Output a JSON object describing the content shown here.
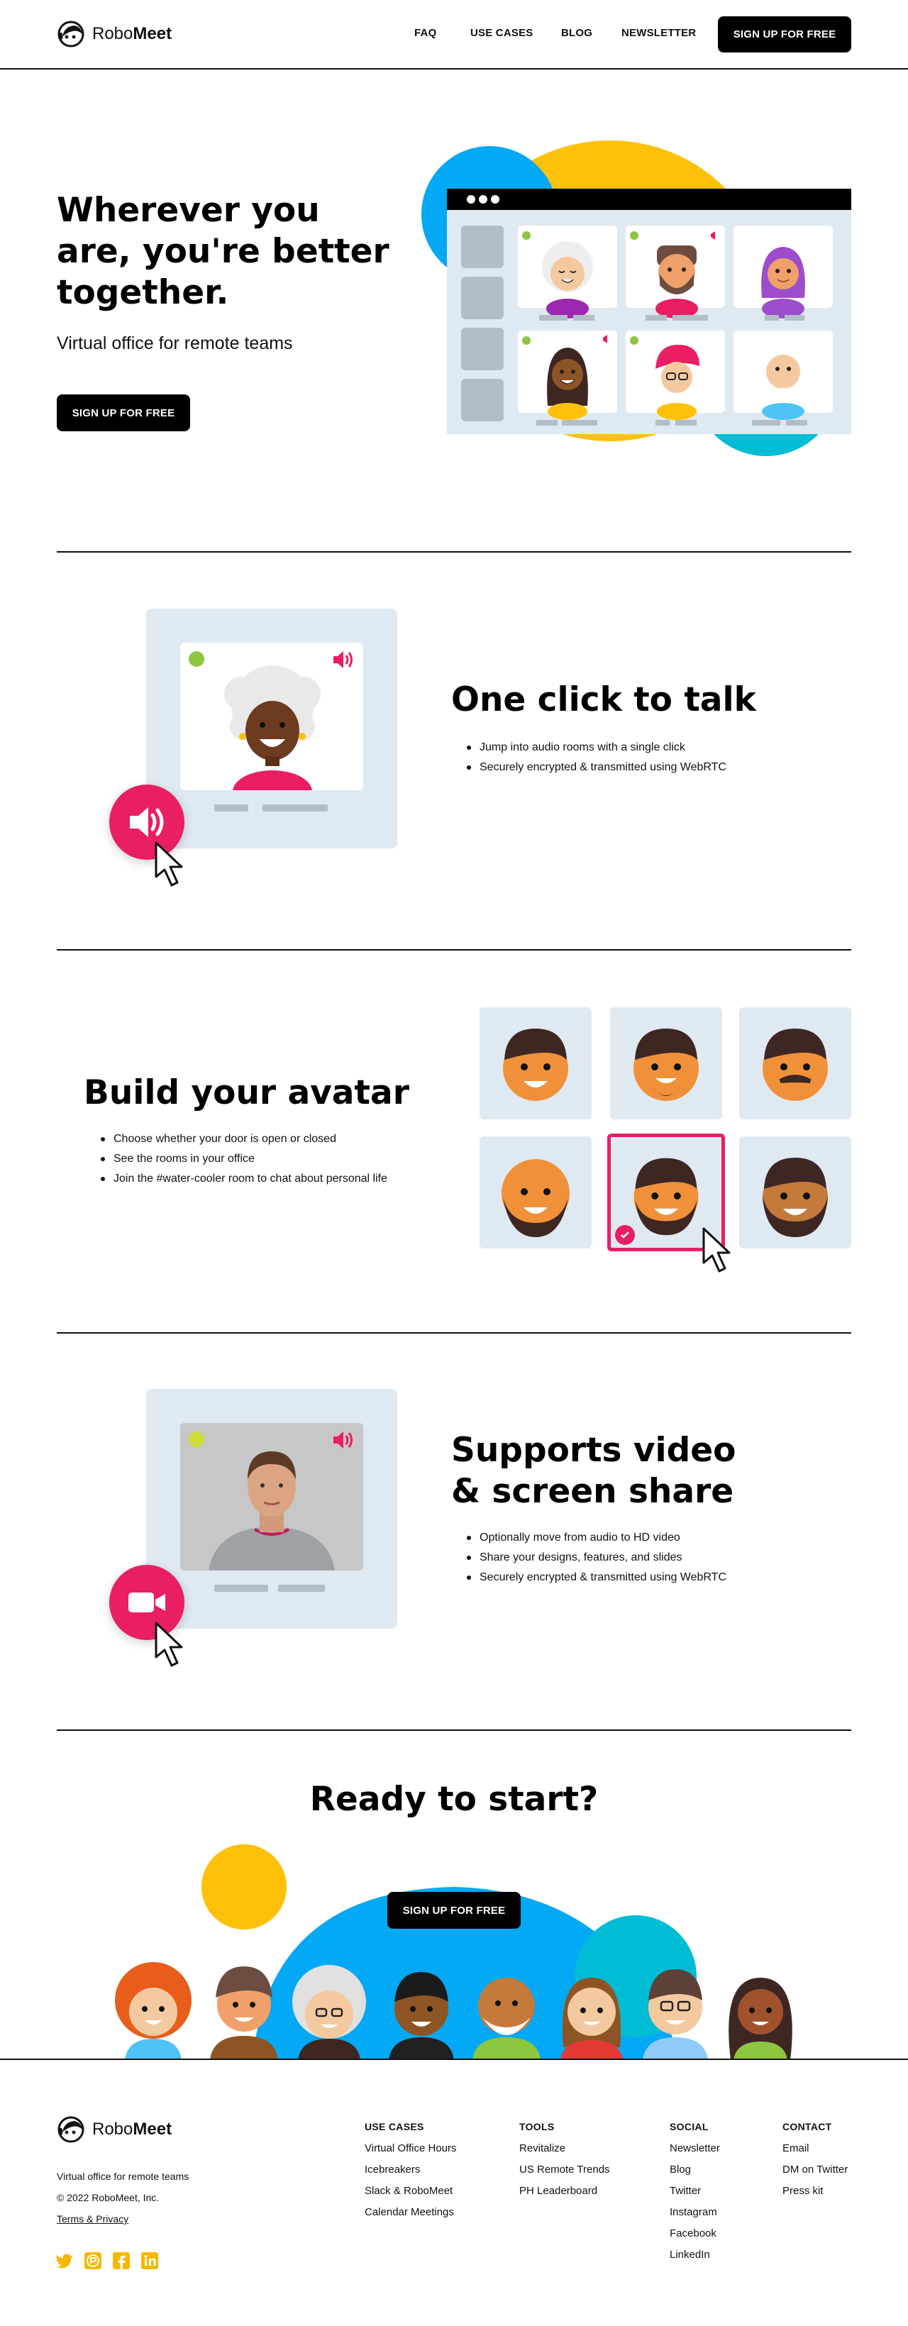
{
  "brand": {
    "name_light": "Robo",
    "name_bold": "Meet"
  },
  "nav": {
    "items": [
      "FAQ",
      "USE CASES",
      "BLOG",
      "NEWSLETTER"
    ],
    "cta": "SIGN UP FOR FREE"
  },
  "hero": {
    "title": "Wherever you are, you're better together.",
    "subtitle": "Virtual office for remote teams",
    "cta": "SIGN UP FOR FREE"
  },
  "features": [
    {
      "title": "One click to talk",
      "bullets": [
        "Jump into audio rooms with a single click",
        "Securely encrypted & transmitted using WebRTC"
      ]
    },
    {
      "title": "Build your avatar",
      "bullets": [
        "Choose whether your door is open or closed",
        "See the rooms in your office",
        "Join the #water-cooler room to chat about personal life"
      ]
    },
    {
      "title": "Supports video & screen share",
      "bullets": [
        "Optionally move from audio to HD video",
        "Share your designs, features, and slides",
        "Securely encrypted & transmitted using WebRTC"
      ]
    }
  ],
  "cta_section": {
    "title": "Ready to start?",
    "button": "SIGN UP FOR FREE"
  },
  "footer": {
    "tagline": "Virtual office for remote teams",
    "copyright": "© 2022 RoboMeet, Inc.",
    "terms": "Terms & Privacy",
    "columns": [
      {
        "title": "USE CASES",
        "links": [
          "Virtual Office Hours",
          "Icebreakers",
          "Slack & RoboMeet",
          "Calendar Meetings"
        ]
      },
      {
        "title": "TOOLS",
        "links": [
          "Revitalize",
          "US Remote Trends",
          "PH Leaderboard"
        ]
      },
      {
        "title": "SOCIAL",
        "links": [
          "Newsletter",
          "Blog",
          "Twitter",
          "Instagram",
          "Facebook",
          "LinkedIn"
        ]
      },
      {
        "title": "CONTACT",
        "links": [
          "Email",
          "DM on Twitter",
          "Press kit"
        ]
      }
    ],
    "social_icons": [
      "twitter-icon",
      "producthunt-icon",
      "facebook-icon",
      "linkedin-icon"
    ]
  },
  "colors": {
    "yellow": "#ffc107",
    "blue": "#03a9f4",
    "teal": "#00bcd4",
    "pink": "#e91e63",
    "green": "#8dc63f",
    "panel": "#dfe9f1",
    "footer_icon": "#f5b800"
  }
}
